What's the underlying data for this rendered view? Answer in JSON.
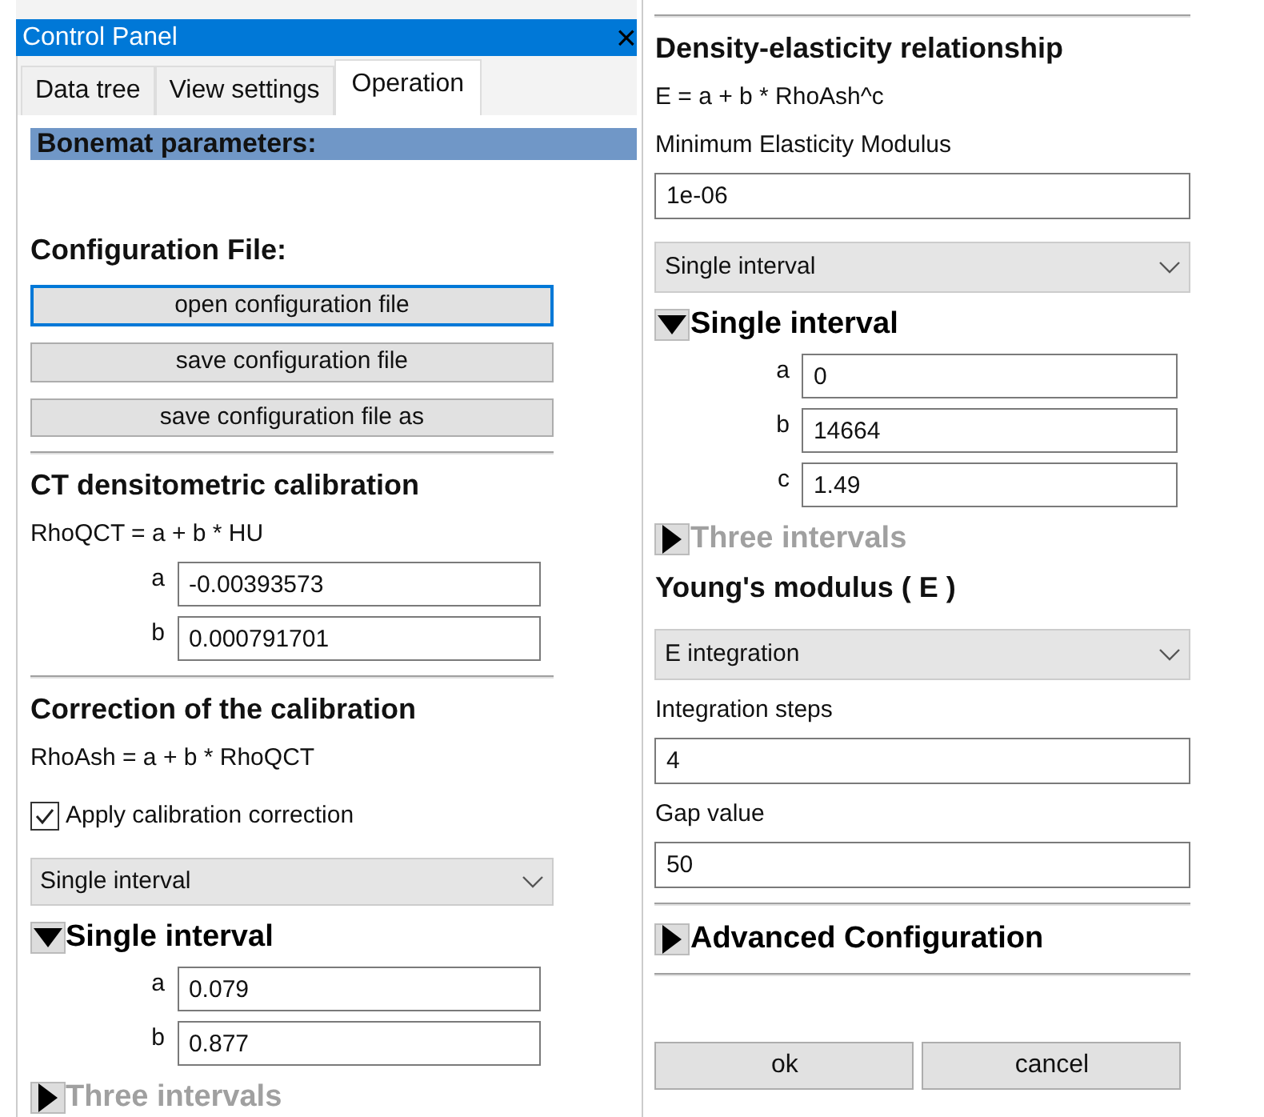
{
  "window": {
    "title": "Control Panel",
    "close": "×"
  },
  "tabs": [
    {
      "label": "Data tree",
      "selected": false
    },
    {
      "label": "View settings",
      "selected": false
    },
    {
      "label": "Operation",
      "selected": true
    }
  ],
  "left_column": [
    {
      "kind": "banner",
      "text": "Bonemat parameters:"
    },
    {
      "kind": "heading",
      "text": "Configuration File:"
    },
    {
      "kind": "button",
      "text": "open configuration file",
      "focused": true
    },
    {
      "kind": "button",
      "text": "save configuration file",
      "focused": false
    },
    {
      "kind": "button",
      "text": "save configuration file as",
      "focused": false
    },
    {
      "kind": "separator"
    },
    {
      "kind": "heading",
      "text": "CT densitometric calibration"
    },
    {
      "kind": "text",
      "text": "RhoQCT = a + b * HU"
    },
    {
      "kind": "param",
      "label": "a",
      "value": "-0.00393573"
    },
    {
      "kind": "param",
      "label": "b",
      "value": "0.000791701"
    },
    {
      "kind": "separator"
    },
    {
      "kind": "heading",
      "text": "Correction of the calibration"
    },
    {
      "kind": "text",
      "text": "RhoAsh = a + b * RhoQCT"
    },
    {
      "kind": "checkbox",
      "text": "Apply calibration correction",
      "checked": true
    },
    {
      "kind": "dropdown",
      "value": "Single interval"
    },
    {
      "kind": "expander",
      "text": "Single interval",
      "expanded": true,
      "disabled": false,
      "children": [
        {
          "kind": "param",
          "label": "a",
          "value": "0.079"
        },
        {
          "kind": "param",
          "label": "b",
          "value": "0.877"
        }
      ]
    },
    {
      "kind": "expander",
      "text": "Three intervals",
      "expanded": false,
      "disabled": true
    }
  ],
  "right_column": [
    {
      "kind": "separator"
    },
    {
      "kind": "heading",
      "text": "Density-elasticity relationship"
    },
    {
      "kind": "text",
      "text": "E = a + b * RhoAsh^c"
    },
    {
      "kind": "text",
      "text": "Minimum Elasticity Modulus"
    },
    {
      "kind": "field",
      "value": "1e-06"
    },
    {
      "kind": "dropdown",
      "value": "Single interval"
    },
    {
      "kind": "expander",
      "text": "Single interval",
      "expanded": true,
      "disabled": false,
      "children": [
        {
          "kind": "param",
          "label": "a",
          "value": "0"
        },
        {
          "kind": "param",
          "label": "b",
          "value": "14664"
        },
        {
          "kind": "param",
          "label": "c",
          "value": "1.49"
        }
      ]
    },
    {
      "kind": "expander",
      "text": "Three intervals",
      "expanded": false,
      "disabled": true
    },
    {
      "kind": "heading",
      "text": "Young's modulus ( E )"
    },
    {
      "kind": "dropdown",
      "value": "E integration"
    },
    {
      "kind": "text",
      "text": "Integration steps"
    },
    {
      "kind": "field",
      "value": "4"
    },
    {
      "kind": "text",
      "text": "Gap value"
    },
    {
      "kind": "field",
      "value": "50"
    },
    {
      "kind": "separator"
    },
    {
      "kind": "expander",
      "text": "Advanced Configuration",
      "expanded": false,
      "disabled": false
    },
    {
      "kind": "separator"
    },
    {
      "kind": "button_row",
      "buttons": [
        "ok",
        "cancel"
      ]
    }
  ]
}
